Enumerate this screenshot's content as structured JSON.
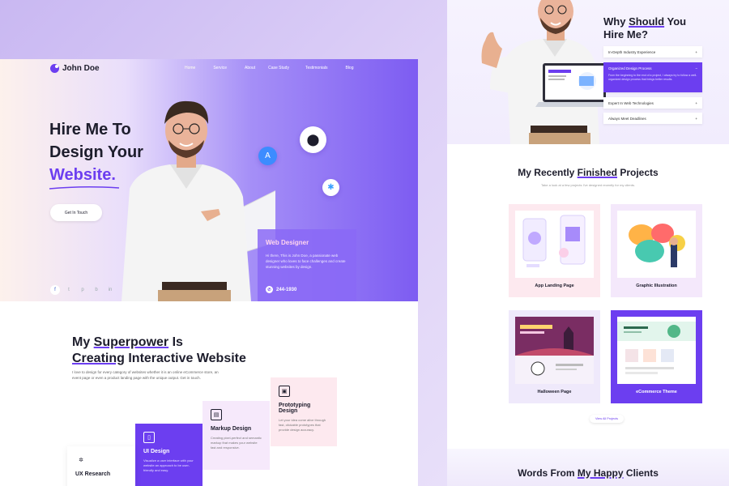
{
  "left": {
    "logo": "John Doe",
    "nav": [
      "Home",
      "Service",
      "About",
      "Case Study",
      "Testimonials",
      "Blog"
    ],
    "hero": {
      "title_line1": "Hire Me To",
      "title_line2": "Design Your",
      "title_highlight": "Website.",
      "cta": "Get In Touch",
      "card_title": "Web Designer",
      "card_text": "Hi there, This is John Doe, a passionate web designer who loves to face challenges and create stunning websites by design.",
      "phone": "244-1930"
    },
    "socials": [
      "f",
      "t",
      "p",
      "b",
      "in"
    ],
    "superpower": {
      "title_a": "My ",
      "title_b": "Superpower",
      "title_c": " Is",
      "title_d": "Creating",
      "title_e": " Interactive Website",
      "desc": "I love to design for every category of websites whether it is an online eCommerce store, an event page or even a product landing page with the unique output. Get in touch.",
      "services": [
        {
          "name": "Prototyping Design",
          "desc": "Let your idea come alive through fast, clickable prototypes that provide design accuracy."
        },
        {
          "name": "Markup Design",
          "desc": "Creating pixel-perfect and semantic markup that makes your website fast and responsive."
        },
        {
          "name": "UI Design",
          "desc": "Visualize a user interface with your website an approach to be user-friendly and easy."
        },
        {
          "name": "UX Research",
          "desc": ""
        }
      ]
    }
  },
  "right": {
    "why": {
      "title_a": "Why ",
      "title_b": "Should",
      "title_c": " You",
      "title_d": "Hire Me?",
      "items": [
        {
          "label": "In-Depth Industry Experience",
          "icon": "+"
        },
        {
          "label": "Organized Design Process",
          "icon": "−",
          "body": "From the beginning to the end of a project, I always try to follow a well-organized design process that brings better results."
        },
        {
          "label": "Expert In Web Technologies",
          "icon": "+"
        },
        {
          "label": "Always Meet Deadlines",
          "icon": "+"
        }
      ]
    },
    "projects": {
      "title_a": "My Recently ",
      "title_b": "Finished",
      "title_c": " Projects",
      "subtitle": "Take a look at a few projects I've designed recently for my clients.",
      "items": [
        "App Landing Page",
        "Graphic Illustration",
        "Halloween Page",
        "eCommerce Theme"
      ],
      "view_more": "View All Projects"
    },
    "clients": {
      "title_a": "Words From ",
      "title_b": "My Happy",
      "title_c": " Clients"
    }
  }
}
